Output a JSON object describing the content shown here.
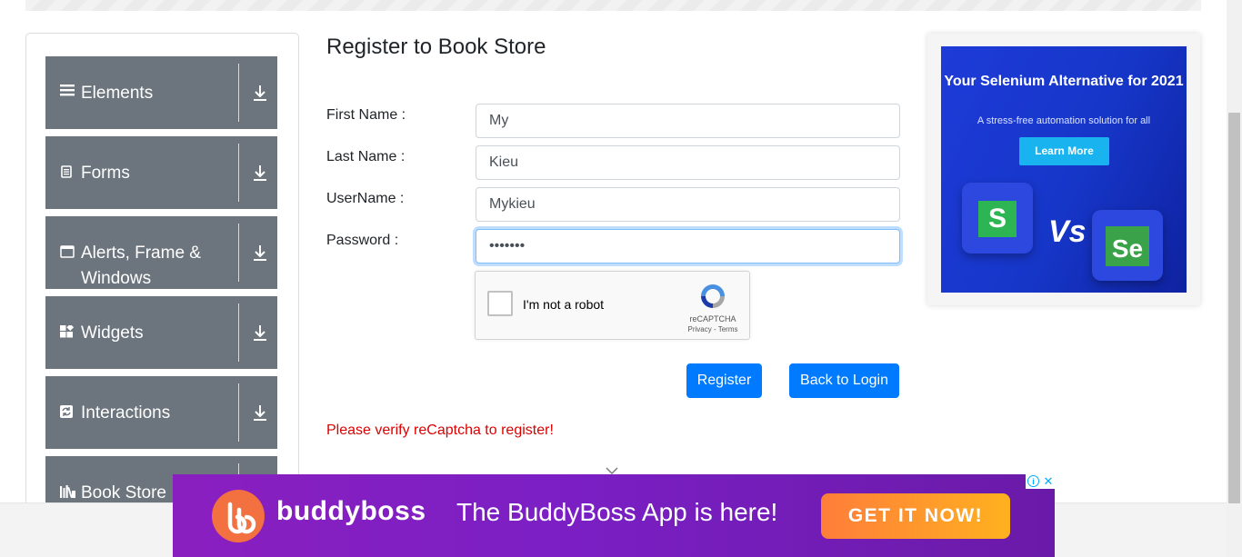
{
  "sidebar": {
    "groups": [
      {
        "label": "Elements",
        "icon": "hamburger-icon"
      },
      {
        "label": "Forms",
        "icon": "document-icon"
      },
      {
        "label": "Alerts, Frame & Windows",
        "icon": "window-icon"
      },
      {
        "label": "Widgets",
        "icon": "widgets-icon"
      },
      {
        "label": "Interactions",
        "icon": "interactions-icon"
      },
      {
        "label": "Book Store",
        "icon": "books-icon"
      }
    ]
  },
  "form": {
    "title": "Register to Book Store",
    "first_name_label": "First Name :",
    "first_name_value": "My",
    "last_name_label": "Last Name :",
    "last_name_value": "Kieu",
    "username_label": "UserName :",
    "username_value": "Mykieu",
    "password_label": "Password :",
    "password_value": "•••••••",
    "captcha": {
      "text": "I'm not a robot",
      "brand": "reCAPTCHA",
      "links": "Privacy - Terms"
    },
    "register_button": "Register",
    "back_button": "Back to Login",
    "error": "Please verify reCaptcha to register!"
  },
  "right_ad": {
    "title": "Your Selenium Alternative for 2021",
    "subtitle": "A stress-free automation solution for all",
    "button": "Learn More",
    "left_logo": "S",
    "vs": "Vs",
    "right_logo": "Se"
  },
  "bottom_ad": {
    "brand": "buddyboss",
    "message": "The BuddyBoss App is here!",
    "cta": "GET IT NOW!"
  },
  "colors": {
    "sidebar_bg": "#6c757d",
    "primary": "#007bff",
    "error": "#dc0000"
  }
}
